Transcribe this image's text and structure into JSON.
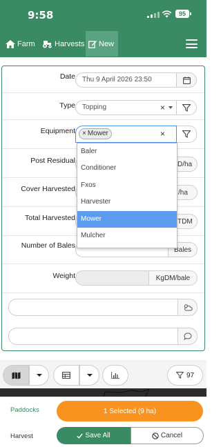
{
  "status": {
    "time": "9:58",
    "battery": "95"
  },
  "nav": {
    "farm": "Farm",
    "harvests": "Harvests",
    "new": "New"
  },
  "form": {
    "date": {
      "label": "Date",
      "value": "Thu 9 April 2026 23:50"
    },
    "type": {
      "label": "Type",
      "value": "Topping",
      "clear": "×"
    },
    "equipment": {
      "label": "Equipment",
      "tag": "Mower",
      "tag_remove": "×",
      "clear": "×"
    },
    "post_residual": {
      "label": "Post Residual",
      "unit_partial": "D/ha"
    },
    "cover_harvested": {
      "label": "Cover Harvested",
      "unit_partial": "/ha"
    },
    "total_harvested": {
      "label": "Total Harvested",
      "unit_partial": "TDM"
    },
    "number_of_bales": {
      "label": "Number of Bales",
      "unit": "Bales"
    },
    "weight": {
      "label": "Weight",
      "unit": "KgDM/bale"
    }
  },
  "dropdown": {
    "options": [
      "Baler",
      "Conditioner",
      "Fxos",
      "Harvester",
      "Mower",
      "Mulcher"
    ],
    "selected": "Mower"
  },
  "toolbar": {
    "filter_count": "97"
  },
  "footer": {
    "paddocks_label": "Paddocks",
    "selected_text": "1 Selected (9 ha)",
    "harvest_label": "Harvest",
    "save_all": "Save All",
    "cancel": "Cancel"
  },
  "colors": {
    "brand": "#3a8a63",
    "accent": "#f7931e",
    "selected_option": "#5b9cf1"
  }
}
